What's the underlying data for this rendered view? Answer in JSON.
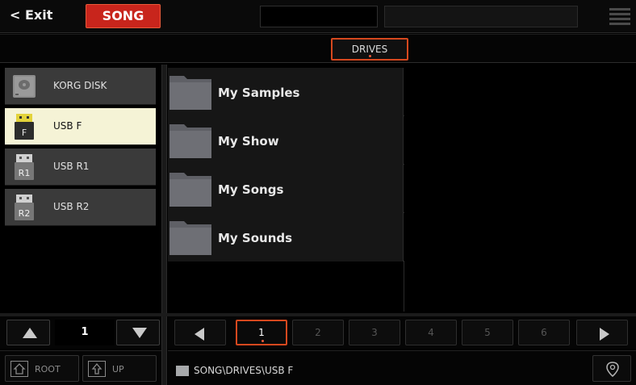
{
  "header": {
    "exit_label": "< Exit",
    "mode_label": "SONG"
  },
  "tabs": [
    {
      "label": "DRIVES",
      "active": true
    }
  ],
  "drives": [
    {
      "label": "KORG DISK",
      "icon": "hard-disk-icon",
      "badge": "",
      "selected": false
    },
    {
      "label": "USB F",
      "icon": "usb-drive-icon",
      "badge": "F",
      "selected": true
    },
    {
      "label": "USB R1",
      "icon": "usb-drive-icon",
      "badge": "R1",
      "selected": false
    },
    {
      "label": "USB R2",
      "icon": "usb-drive-icon",
      "badge": "R2",
      "selected": false
    }
  ],
  "folders": [
    {
      "label": "My Samples",
      "icon": "folder-icon"
    },
    {
      "label": "My Show",
      "icon": "folder-icon"
    },
    {
      "label": "My Songs",
      "icon": "folder-icon"
    },
    {
      "label": "My Sounds",
      "icon": "folder-icon"
    }
  ],
  "left_nav": {
    "page": "1"
  },
  "pages": {
    "items": [
      "1",
      "2",
      "3",
      "4",
      "5",
      "6"
    ],
    "active": "1"
  },
  "bottom": {
    "root_label": "ROOT",
    "up_label": "UP",
    "path": "SONG\\DRIVES\\USB F"
  },
  "colors": {
    "accent": "#c8251c",
    "highlight_border": "#d6481e",
    "selected_row": "#f5f3d6",
    "drive_bg": "#3a3a3a"
  }
}
